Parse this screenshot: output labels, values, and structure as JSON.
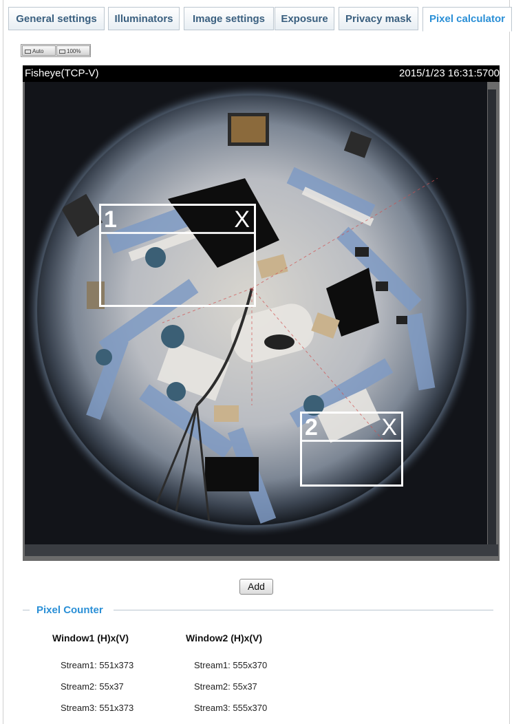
{
  "tabs": [
    {
      "label": "General settings",
      "active": false
    },
    {
      "label": "Illuminators",
      "active": false
    },
    {
      "label": "Image settings",
      "active": false
    },
    {
      "label": "Exposure",
      "active": false
    },
    {
      "label": "Privacy mask",
      "active": false
    },
    {
      "label": "Pixel calculator",
      "active": true
    }
  ],
  "view_buttons": {
    "auto": "Auto",
    "full": "100%"
  },
  "video": {
    "stream_name": "Fisheye(TCP-V)",
    "timestamp": "2015/1/23 16:31:57",
    "timestamp_overflow": "00"
  },
  "windows": [
    {
      "number": "1",
      "close_label": "X"
    },
    {
      "number": "2",
      "close_label": "X"
    }
  ],
  "add_button": "Add",
  "pixel_counter": {
    "title": "Pixel Counter",
    "window1": {
      "header": "Window1 (H)x(V)",
      "streams": [
        "Stream1: 551x373",
        "Stream2: 55x37",
        "Stream3: 551x373"
      ]
    },
    "window2": {
      "header": "Window2 (H)x(V)",
      "streams": [
        "Stream1: 555x370",
        "Stream2: 55x37",
        "Stream3: 555x370"
      ]
    }
  },
  "colors": {
    "accent": "#2a8fd6",
    "tab_text": "#3a5f7f"
  }
}
